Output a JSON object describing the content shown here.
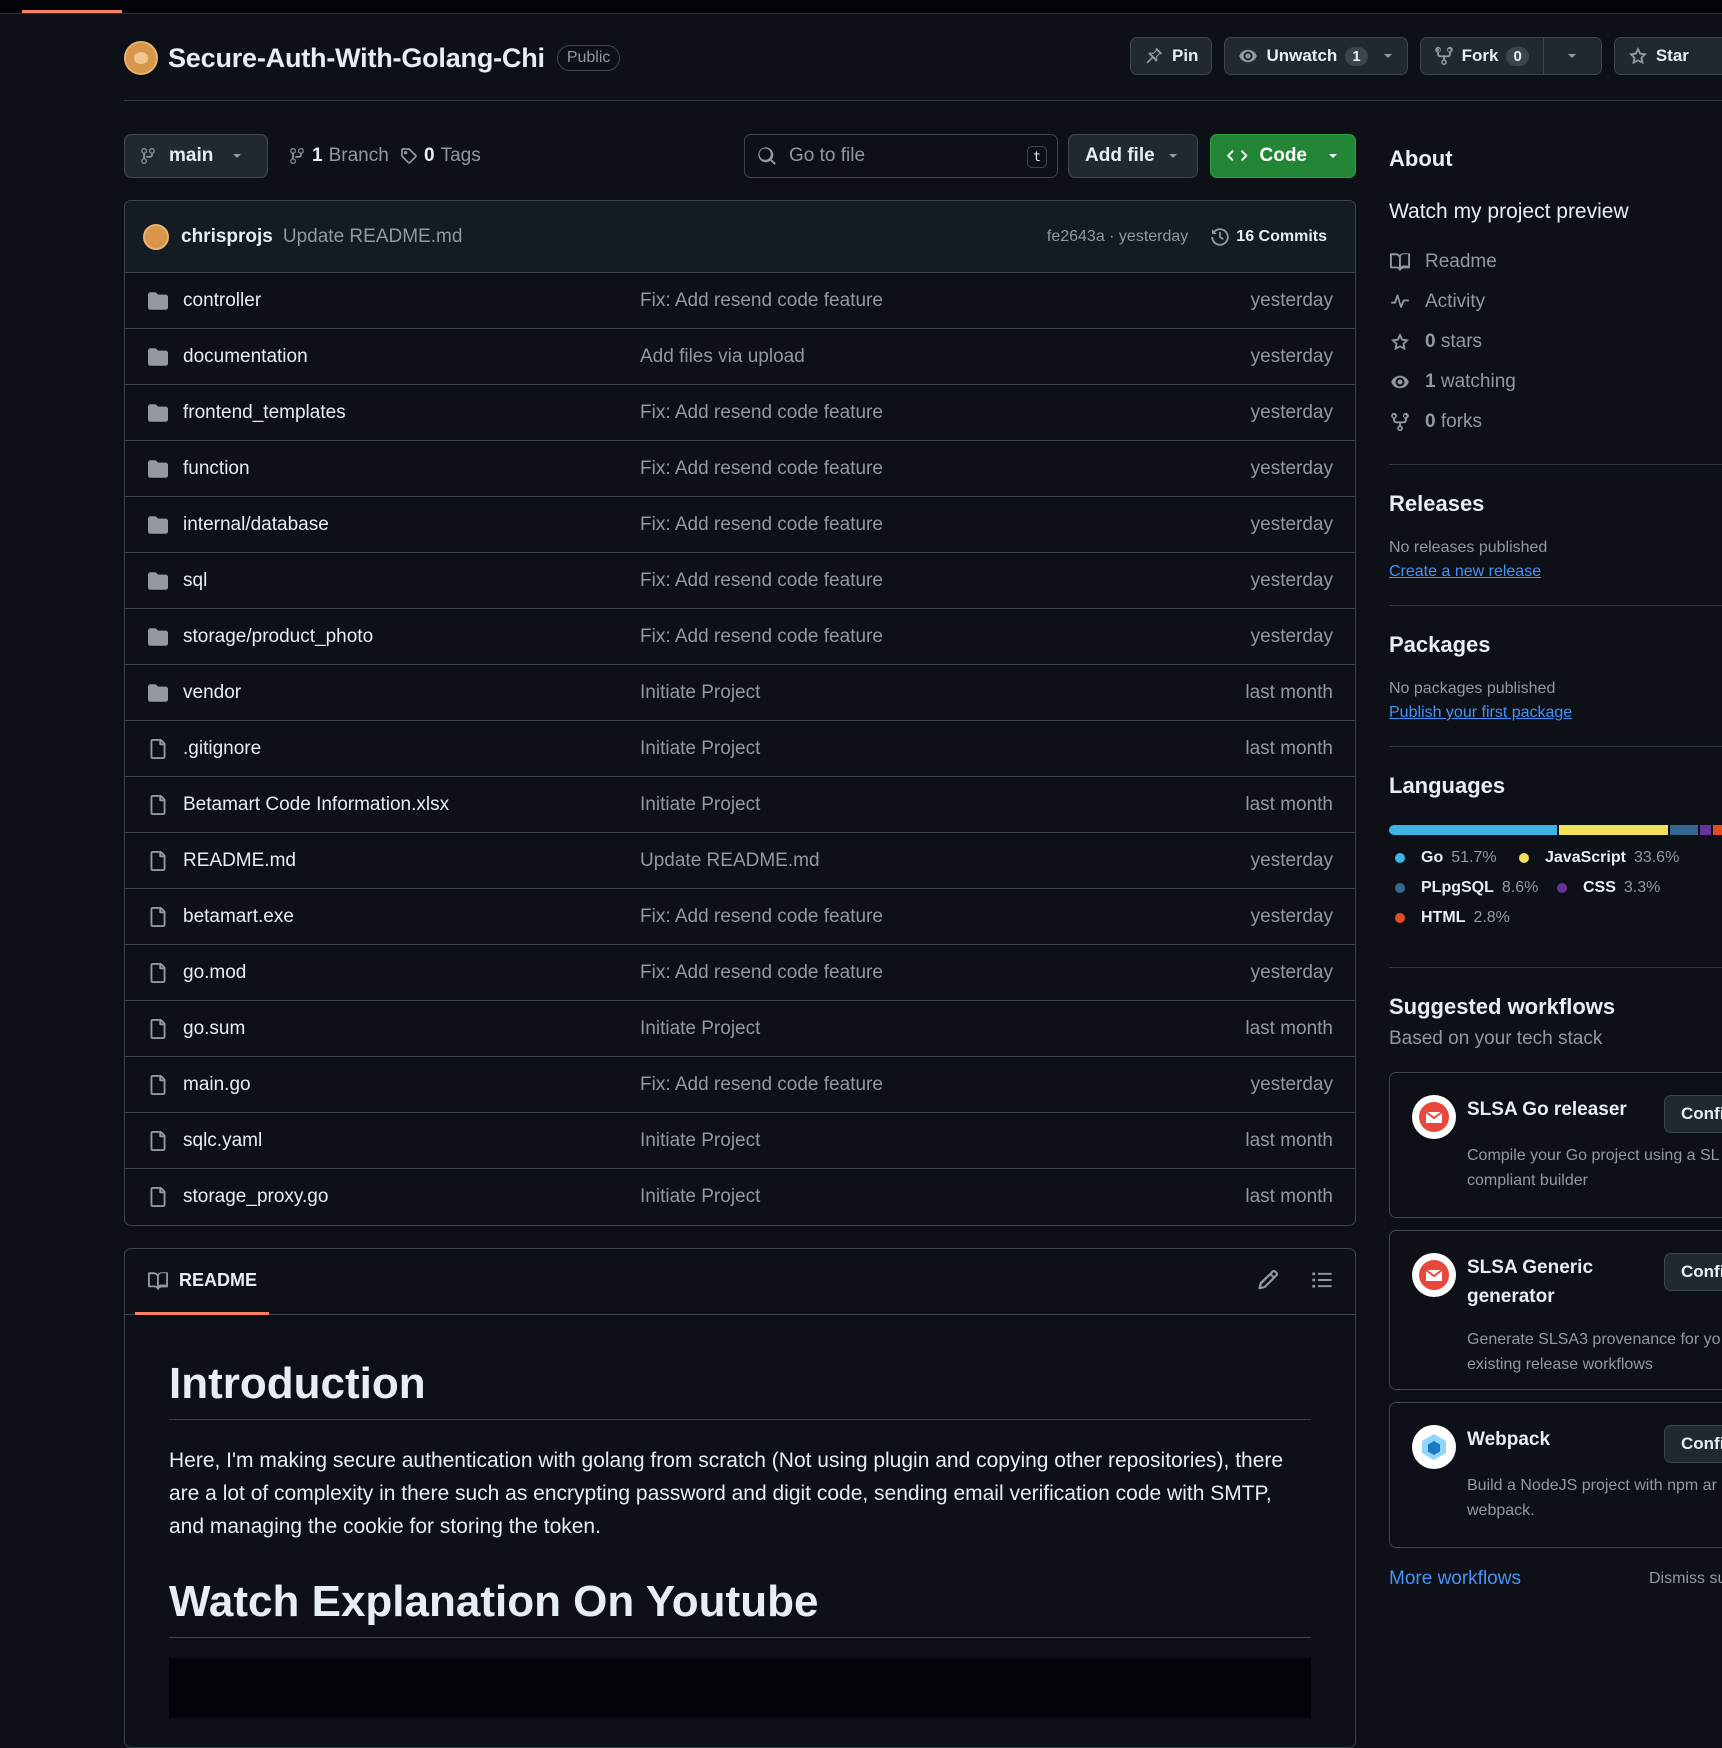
{
  "repo": {
    "name": "Secure-Auth-With-Golang-Chi",
    "visibility": "Public"
  },
  "header_actions": {
    "pin": "Pin",
    "unwatch": "Unwatch",
    "watch_count": "1",
    "fork": "Fork",
    "fork_count": "0",
    "star": "Star"
  },
  "toolbar": {
    "branch": "main",
    "branch_count": "1",
    "branch_label": "Branch",
    "tag_count": "0",
    "tag_label": "Tags",
    "search_placeholder": "Go to file",
    "search_shortcut": "t",
    "add_file": "Add file",
    "code": "Code"
  },
  "latest_commit": {
    "author": "chrisprojs",
    "message": "Update README.md",
    "hash_time": "fe2643a · yesterday",
    "commits": "16 Commits"
  },
  "files": [
    {
      "name": "controller",
      "type": "dir",
      "message": "Fix: Add resend code feature",
      "time": "yesterday"
    },
    {
      "name": "documentation",
      "type": "dir",
      "message": "Add files via upload",
      "time": "yesterday"
    },
    {
      "name": "frontend_templates",
      "type": "dir",
      "message": "Fix: Add resend code feature",
      "time": "yesterday"
    },
    {
      "name": "function",
      "type": "dir",
      "message": "Fix: Add resend code feature",
      "time": "yesterday"
    },
    {
      "name": "internal/database",
      "type": "dir",
      "message": "Fix: Add resend code feature",
      "time": "yesterday"
    },
    {
      "name": "sql",
      "type": "dir",
      "message": "Fix: Add resend code feature",
      "time": "yesterday"
    },
    {
      "name": "storage/product_photo",
      "type": "dir",
      "message": "Fix: Add resend code feature",
      "time": "yesterday"
    },
    {
      "name": "vendor",
      "type": "dir",
      "message": "Initiate Project",
      "time": "last month"
    },
    {
      "name": ".gitignore",
      "type": "file",
      "message": "Initiate Project",
      "time": "last month"
    },
    {
      "name": "Betamart Code Information.xlsx",
      "type": "file",
      "message": "Initiate Project",
      "time": "last month"
    },
    {
      "name": "README.md",
      "type": "file",
      "message": "Update README.md",
      "time": "yesterday"
    },
    {
      "name": "betamart.exe",
      "type": "file",
      "message": "Fix: Add resend code feature",
      "time": "yesterday"
    },
    {
      "name": "go.mod",
      "type": "file",
      "message": "Fix: Add resend code feature",
      "time": "yesterday"
    },
    {
      "name": "go.sum",
      "type": "file",
      "message": "Initiate Project",
      "time": "last month"
    },
    {
      "name": "main.go",
      "type": "file",
      "message": "Fix: Add resend code feature",
      "time": "yesterday"
    },
    {
      "name": "sqlc.yaml",
      "type": "file",
      "message": "Initiate Project",
      "time": "last month"
    },
    {
      "name": "storage_proxy.go",
      "type": "file",
      "message": "Initiate Project",
      "time": "last month"
    }
  ],
  "readme": {
    "tab": "README",
    "h1": "Introduction",
    "paragraph": "Here, I'm making secure authentication with golang from scratch (Not using plugin and copying other repositories), there are a lot of complexity in there such as encrypting password and digit code, sending email verification code with SMTP, and managing the cookie for storing the token.",
    "h2": "Watch Explanation On Youtube"
  },
  "about": {
    "title": "About",
    "description": "Watch my project preview",
    "readme": "Readme",
    "activity": "Activity",
    "stars_count": "0",
    "stars_label": "stars",
    "watching_count": "1",
    "watching_label": "watching",
    "forks_count": "0",
    "forks_label": "forks"
  },
  "releases": {
    "title": "Releases",
    "empty": "No releases published",
    "link": "Create a new release"
  },
  "packages": {
    "title": "Packages",
    "empty": "No packages published",
    "link": "Publish your first package"
  },
  "languages": {
    "title": "Languages",
    "items": [
      {
        "name": "Go",
        "percent": "51.7%",
        "value": 51.7,
        "color": "#3fb3e6"
      },
      {
        "name": "JavaScript",
        "percent": "33.6%",
        "value": 33.6,
        "color": "#f1e05a"
      },
      {
        "name": "PLpgSQL",
        "percent": "8.6%",
        "value": 8.6,
        "color": "#336790"
      },
      {
        "name": "CSS",
        "percent": "3.3%",
        "value": 3.3,
        "color": "#663399"
      },
      {
        "name": "HTML",
        "percent": "2.8%",
        "value": 2.8,
        "color": "#e34c26"
      }
    ]
  },
  "workflows": {
    "title": "Suggested workflows",
    "subtitle": "Based on your tech stack",
    "items": [
      {
        "title": "SLSA Go releaser",
        "desc": "Compile your Go project using a SL compliant builder",
        "button": "Confi"
      },
      {
        "title": "SLSA Generic generator",
        "desc": "Generate SLSA3 provenance for yo existing release workflows",
        "button": "Confi"
      },
      {
        "title": "Webpack",
        "desc": "Build a NodeJS project with npm ar webpack.",
        "button": "Confi"
      }
    ],
    "more": "More workflows",
    "dismiss": "Dismiss su"
  }
}
